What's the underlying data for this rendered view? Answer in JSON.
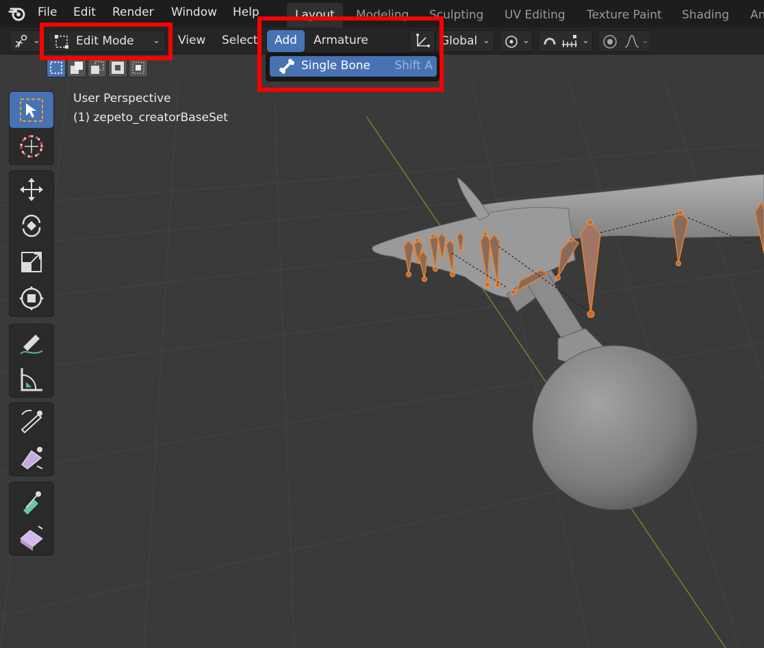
{
  "menubar": {
    "items": [
      "File",
      "Edit",
      "Render",
      "Window",
      "Help"
    ],
    "workspace_tabs": [
      "Layout",
      "Modeling",
      "Sculpting",
      "UV Editing",
      "Texture Paint",
      "Shading",
      "An"
    ]
  },
  "header": {
    "mode": "Edit Mode",
    "view": "View",
    "select": "Select",
    "add": "Add",
    "armature": "Armature",
    "orientation": "Global"
  },
  "viewport": {
    "perspective_label": "User Perspective",
    "object_label": "(1) zepeto_creatorBaseSet"
  },
  "add_menu": {
    "item_label": "Single Bone",
    "item_shortcut": "Shift A"
  },
  "colors": {
    "highlight": "#ff0000",
    "accent": "#4772b3",
    "bone_orange": "#e8832a",
    "floor_line": "#6b8f2a"
  },
  "icons": [
    "blender-logo-icon",
    "armature-editor-icon",
    "edit-mode-icon",
    "bone-icon",
    "transform-orientation-icon",
    "snap-icon",
    "proportional-editing-icon"
  ]
}
